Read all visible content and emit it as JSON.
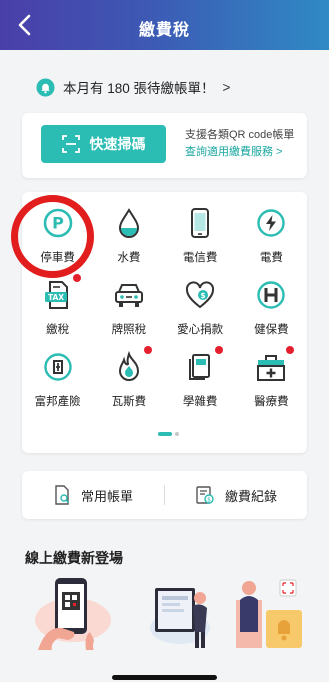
{
  "header": {
    "title": "繳費稅"
  },
  "notice": {
    "text": "本月有 180 張待繳帳單！",
    "chevron": ">"
  },
  "scan": {
    "button_label": "快速掃碼",
    "info_line1": "支援各類QR code帳單",
    "info_line2": "查詢適用繳費服務 >"
  },
  "categories": [
    {
      "label": "停車費",
      "icon": "parking-icon",
      "badge": false
    },
    {
      "label": "水費",
      "icon": "water-drop-icon",
      "badge": false
    },
    {
      "label": "電信費",
      "icon": "phone-icon",
      "badge": false
    },
    {
      "label": "電費",
      "icon": "lightning-icon",
      "badge": false
    },
    {
      "label": "繳稅",
      "icon": "tax-icon",
      "badge": true
    },
    {
      "label": "牌照稅",
      "icon": "car-icon",
      "badge": false
    },
    {
      "label": "愛心捐款",
      "icon": "heart-donation-icon",
      "badge": false
    },
    {
      "label": "健保費",
      "icon": "health-insurance-icon",
      "badge": false
    },
    {
      "label": "富邦產險",
      "icon": "insurance-icon",
      "badge": false
    },
    {
      "label": "瓦斯費",
      "icon": "gas-flame-icon",
      "badge": true
    },
    {
      "label": "學雜費",
      "icon": "tuition-icon",
      "badge": true
    },
    {
      "label": "醫療費",
      "icon": "medical-kit-icon",
      "badge": true
    }
  ],
  "links": {
    "common_bills": "常用帳單",
    "payment_history": "繳費紀錄"
  },
  "promo": {
    "title": "線上繳費新登場"
  },
  "colors": {
    "accent": "#2bbcb3",
    "badge": "#e5202e",
    "header_start": "#4a3fa9",
    "header_end": "#2f8ac4",
    "annotation": "#e21d1d"
  }
}
